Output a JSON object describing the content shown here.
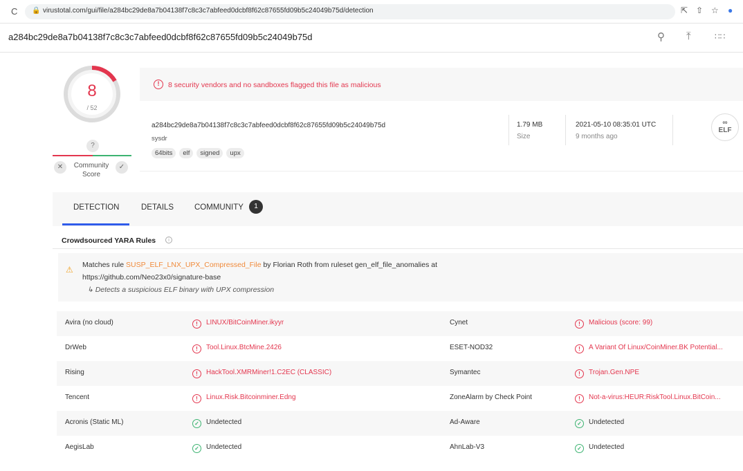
{
  "browser": {
    "url": "virustotal.com/gui/file/a284bc29de8a7b04138f7c8c3c7abfeed0dcbf8f62c87655fd09b5c24049b75d/detection",
    "reload_icon": "C"
  },
  "search": {
    "value": "a284bc29de8a7b04138f7c8c3c7abfeed0dcbf8f62c87655fd09b5c24049b75d"
  },
  "score": {
    "detections": "8",
    "total": "/ 52",
    "unknown": "?",
    "community_label": "Community Score"
  },
  "alert": {
    "icon": "!",
    "text": "8 security vendors and no sandboxes flagged this file as malicious"
  },
  "file": {
    "hash": "a284bc29de8a7b04138f7c8c3c7abfeed0dcbf8f62c87655fd09b5c24049b75d",
    "name": "sysdr",
    "tags": [
      "64bits",
      "elf",
      "signed",
      "upx"
    ],
    "size_value": "1.79 MB",
    "size_label": "Size",
    "date_value": "2021-05-10 08:35:01 UTC",
    "date_label": "9 months ago",
    "type_label": "ELF"
  },
  "tabs": {
    "detection": "DETECTION",
    "details": "DETAILS",
    "community": "COMMUNITY",
    "community_count": "1"
  },
  "yara": {
    "title": "Crowdsourced YARA Rules",
    "line1_prefix": "Matches rule ",
    "rule": "SUSP_ELF_LNX_UPX_Compressed_File",
    "line1_suffix": " by Florian Roth from ruleset gen_elf_file_anomalies at",
    "line2": "https://github.com/Neo23x0/signature-base",
    "line3": "↳ Detects a suspicious ELF binary with UPX compression"
  },
  "detections": [
    {
      "e1": "Avira (no cloud)",
      "r1": "LINUX/BitCoinMiner.ikyyr",
      "s1": "mal",
      "e2": "Cynet",
      "r2": "Malicious (score: 99)",
      "s2": "mal"
    },
    {
      "e1": "DrWeb",
      "r1": "Tool.Linux.BtcMine.2426",
      "s1": "mal",
      "e2": "ESET-NOD32",
      "r2": "A Variant Of Linux/CoinMiner.BK Potential...",
      "s2": "mal"
    },
    {
      "e1": "Rising",
      "r1": "HackTool.XMRMiner!1.C2EC (CLASSIC)",
      "s1": "mal",
      "e2": "Symantec",
      "r2": "Trojan.Gen.NPE",
      "s2": "mal"
    },
    {
      "e1": "Tencent",
      "r1": "Linux.Risk.Bitcoinminer.Edng",
      "s1": "mal",
      "e2": "ZoneAlarm by Check Point",
      "r2": "Not-a-virus:HEUR:RiskTool.Linux.BitCoin...",
      "s2": "mal"
    },
    {
      "e1": "Acronis (Static ML)",
      "r1": "Undetected",
      "s1": "ok",
      "e2": "Ad-Aware",
      "r2": "Undetected",
      "s2": "ok"
    },
    {
      "e1": "AegisLab",
      "r1": "Undetected",
      "s1": "ok",
      "e2": "AhnLab-V3",
      "r2": "Undetected",
      "s2": "ok"
    }
  ]
}
